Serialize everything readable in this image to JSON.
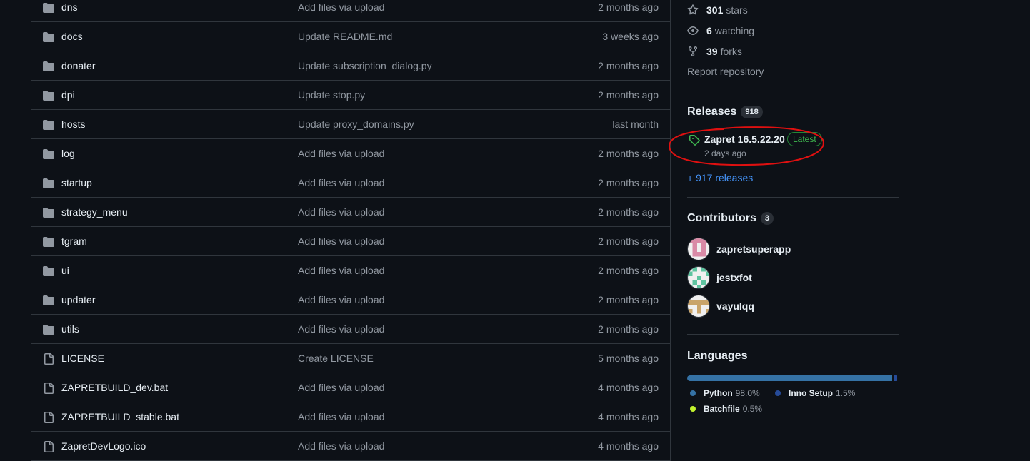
{
  "files": [
    {
      "type": "dir",
      "name": "dns",
      "message": "Add files via upload",
      "date": "2 months ago"
    },
    {
      "type": "dir",
      "name": "docs",
      "message": "Update README.md",
      "date": "3 weeks ago"
    },
    {
      "type": "dir",
      "name": "donater",
      "message": "Update subscription_dialog.py",
      "date": "2 months ago"
    },
    {
      "type": "dir",
      "name": "dpi",
      "message": "Update stop.py",
      "date": "2 months ago"
    },
    {
      "type": "dir",
      "name": "hosts",
      "message": "Update proxy_domains.py",
      "date": "last month"
    },
    {
      "type": "dir",
      "name": "log",
      "message": "Add files via upload",
      "date": "2 months ago"
    },
    {
      "type": "dir",
      "name": "startup",
      "message": "Add files via upload",
      "date": "2 months ago"
    },
    {
      "type": "dir",
      "name": "strategy_menu",
      "message": "Add files via upload",
      "date": "2 months ago"
    },
    {
      "type": "dir",
      "name": "tgram",
      "message": "Add files via upload",
      "date": "2 months ago"
    },
    {
      "type": "dir",
      "name": "ui",
      "message": "Add files via upload",
      "date": "2 months ago"
    },
    {
      "type": "dir",
      "name": "updater",
      "message": "Add files via upload",
      "date": "2 months ago"
    },
    {
      "type": "dir",
      "name": "utils",
      "message": "Add files via upload",
      "date": "2 months ago"
    },
    {
      "type": "file",
      "name": "LICENSE",
      "message": "Create LICENSE",
      "date": "5 months ago"
    },
    {
      "type": "file",
      "name": "ZAPRETBUILD_dev.bat",
      "message": "Add files via upload",
      "date": "4 months ago"
    },
    {
      "type": "file",
      "name": "ZAPRETBUILD_stable.bat",
      "message": "Add files via upload",
      "date": "4 months ago"
    },
    {
      "type": "file",
      "name": "ZapretDevLogo.ico",
      "message": "Add files via upload",
      "date": "4 months ago"
    }
  ],
  "stats": {
    "stars_count": "301",
    "stars_label": "stars",
    "watching_count": "6",
    "watching_label": "watching",
    "forks_count": "39",
    "forks_label": "forks",
    "report": "Report repository"
  },
  "releases": {
    "title": "Releases",
    "count": "918",
    "latest_name": "Zapret 16.5.22.20",
    "latest_badge": "Latest",
    "latest_date": "2 days ago",
    "more_link": "+ 917 releases"
  },
  "contributors": {
    "title": "Contributors",
    "count": "3",
    "list": [
      {
        "name": "zapretsuperapp",
        "avatar_color": "#d98aa6"
      },
      {
        "name": "jestxfot",
        "avatar_color": "#5ec4a0"
      },
      {
        "name": "vayulqq",
        "avatar_color": "#c9a46a"
      }
    ]
  },
  "languages": {
    "title": "Languages",
    "list": [
      {
        "name": "Python",
        "percent": "98.0%",
        "value": 98.0,
        "color": "#3572A5"
      },
      {
        "name": "Inno Setup",
        "percent": "1.5%",
        "value": 1.5,
        "color": "#264b99"
      },
      {
        "name": "Batchfile",
        "percent": "0.5%",
        "value": 0.5,
        "color": "#C1F12E"
      }
    ]
  },
  "colors": {
    "background": "#0d1117",
    "border": "#30363d",
    "text_primary": "#e6edf3",
    "text_muted": "#9198a1",
    "link": "#4493f8",
    "latest_green": "#3fb950",
    "annotation_red": "#e01010"
  },
  "icons": {
    "directory": "folder-icon",
    "file": "file-icon",
    "stars": "star-icon",
    "watching": "eye-icon",
    "forks": "fork-icon",
    "release": "tag-icon"
  }
}
